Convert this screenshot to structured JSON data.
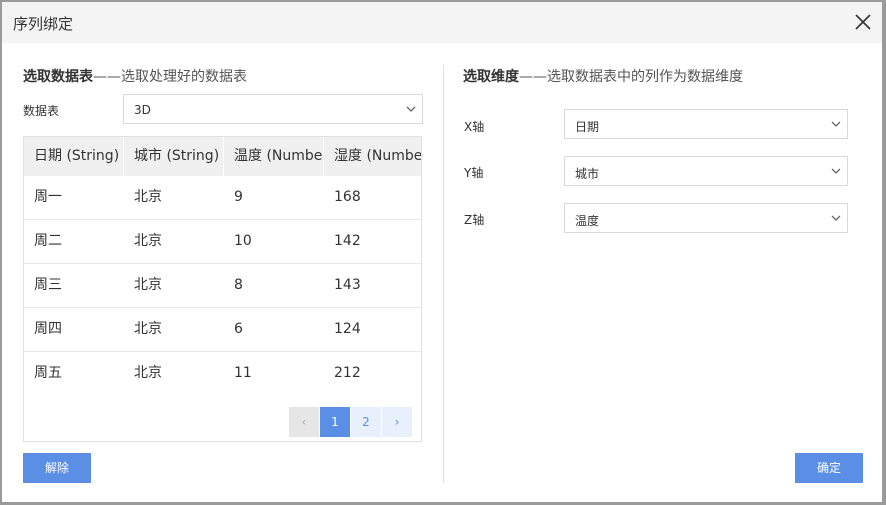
{
  "dialog": {
    "title": "序列绑定"
  },
  "left": {
    "heading_bold": "选取数据表",
    "heading_sub": "——选取处理好的数据表",
    "table_label": "数据表",
    "table_select_value": "3D",
    "columns": [
      "日期 (String)",
      "城市 (String)",
      "温度 (Number)",
      "湿度 (Number)"
    ],
    "rows": [
      [
        "周一",
        "北京",
        "9",
        "168"
      ],
      [
        "周二",
        "北京",
        "10",
        "142"
      ],
      [
        "周三",
        "北京",
        "8",
        "143"
      ],
      [
        "周四",
        "北京",
        "6",
        "124"
      ],
      [
        "周五",
        "北京",
        "11",
        "212"
      ]
    ],
    "pager": {
      "prev": "‹",
      "pages": [
        "1",
        "2"
      ],
      "current": "1",
      "next": "›"
    },
    "unbind_button": "解除"
  },
  "right": {
    "heading_bold": "选取维度",
    "heading_sub": "——选取数据表中的列作为数据维度",
    "x_label": "X轴",
    "x_value": "日期",
    "y_label": "Y轴",
    "y_value": "城市",
    "z_label": "Z轴",
    "z_value": "温度",
    "confirm_button": "确定"
  },
  "colors": {
    "primary": "#5b8fe6",
    "border": "#d9d9d9"
  }
}
